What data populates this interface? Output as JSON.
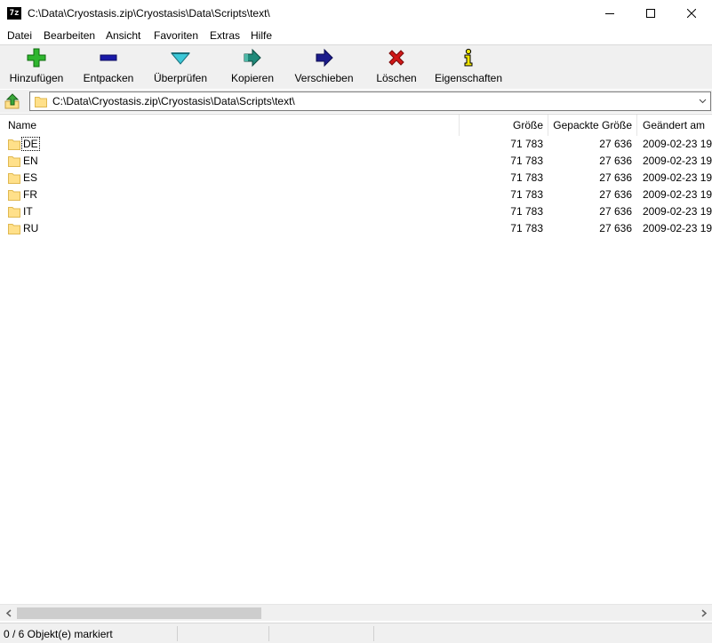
{
  "window": {
    "app_icon_text": "7z",
    "title": "C:\\Data\\Cryostasis.zip\\Cryostasis\\Data\\Scripts\\text\\"
  },
  "menu": [
    "Datei",
    "Bearbeiten",
    "Ansicht",
    "Favoriten",
    "Extras",
    "Hilfe"
  ],
  "toolbar": {
    "add": "Hinzufügen",
    "extract": "Entpacken",
    "test": "Überprüfen",
    "copy": "Kopieren",
    "move": "Verschieben",
    "delete": "Löschen",
    "info": "Eigenschaften"
  },
  "address": {
    "path": "C:\\Data\\Cryostasis.zip\\Cryostasis\\Data\\Scripts\\text\\"
  },
  "columns": {
    "name": "Name",
    "size": "Größe",
    "packed": "Gepackte Größe",
    "modified": "Geändert am"
  },
  "rows": [
    {
      "name": "DE",
      "size": "71 783",
      "packed": "27 636",
      "modified": "2009-02-23 19:"
    },
    {
      "name": "EN",
      "size": "71 783",
      "packed": "27 636",
      "modified": "2009-02-23 19:"
    },
    {
      "name": "ES",
      "size": "71 783",
      "packed": "27 636",
      "modified": "2009-02-23 19:"
    },
    {
      "name": "FR",
      "size": "71 783",
      "packed": "27 636",
      "modified": "2009-02-23 19:"
    },
    {
      "name": "IT",
      "size": "71 783",
      "packed": "27 636",
      "modified": "2009-02-23 19:"
    },
    {
      "name": "RU",
      "size": "71 783",
      "packed": "27 636",
      "modified": "2009-02-23 19:"
    }
  ],
  "status": {
    "selection": "0 / 6 Objekt(e) markiert"
  },
  "colors": {
    "toolbar_bg": "#f0f0f0",
    "folder_yellow": "#ffe08a",
    "add_green": "#2fb62f",
    "extract_blue": "#1a1aa8",
    "test_cyan": "#3cc8d8",
    "copy_teal": "#1f8a7a",
    "move_navy": "#1c1c8c",
    "delete_red": "#d01818",
    "info_yellow": "#f2e600"
  }
}
